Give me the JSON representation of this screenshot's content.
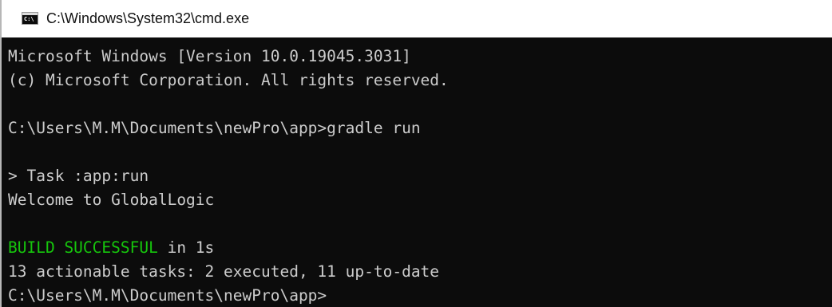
{
  "window": {
    "title": "C:\\Windows\\System32\\cmd.exe",
    "icon": "cmd-icon"
  },
  "colors": {
    "console_background": "#0c0c0c",
    "console_text": "#cccccc",
    "success_green": "#16c60c"
  },
  "console": {
    "lines": [
      "Microsoft Windows [Version 10.0.19045.3031]",
      "(c) Microsoft Corporation. All rights reserved.",
      "",
      "C:\\Users\\M.M\\Documents\\newPro\\app>gradle run",
      "",
      "> Task :app:run",
      "Welcome to GlobalLogic",
      "",
      "",
      "13 actionable tasks: 2 executed, 11 up-to-date",
      "C:\\Users\\M.M\\Documents\\newPro\\app>"
    ],
    "build_status": "BUILD SUCCESSFUL",
    "build_time": " in 1s"
  }
}
